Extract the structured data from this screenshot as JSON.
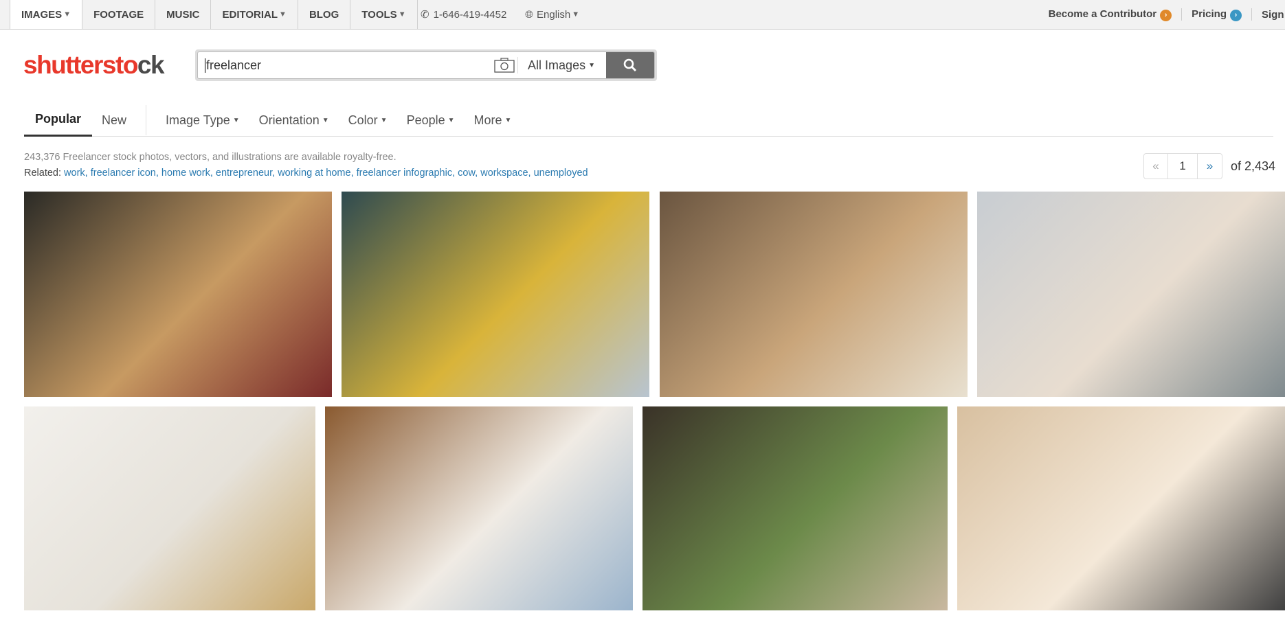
{
  "topnav": {
    "items": [
      {
        "label": "IMAGES",
        "caret": true
      },
      {
        "label": "FOOTAGE",
        "caret": false
      },
      {
        "label": "MUSIC",
        "caret": false
      },
      {
        "label": "EDITORIAL",
        "caret": true
      },
      {
        "label": "BLOG",
        "caret": false
      },
      {
        "label": "TOOLS",
        "caret": true
      }
    ],
    "phone": "1-646-419-4452",
    "language": "English",
    "contributor": "Become a Contributor",
    "pricing": "Pricing",
    "signin": "Sign In",
    "contributor_color": "#e0892a",
    "pricing_color": "#3a97c4"
  },
  "logo": {
    "text_a": "shutterst",
    "text_b": "o",
    "text_c": "ck"
  },
  "search": {
    "query": "freelancer",
    "scope": "All Images"
  },
  "filters": {
    "sort": [
      "Popular",
      "New"
    ],
    "active": "Popular",
    "menus": [
      "Image Type",
      "Orientation",
      "Color",
      "People",
      "More"
    ]
  },
  "results": {
    "count_text": "243,376 Freelancer stock photos, vectors, and illustrations are available royalty-free.",
    "related_label": "Related:",
    "related": [
      "work",
      "freelancer icon",
      "home work",
      "entrepreneur",
      "working at home",
      "freelancer infographic",
      "cow",
      "workspace",
      "unemployed"
    ]
  },
  "pagination": {
    "prev": "«",
    "page": "1",
    "next": "»",
    "of": "of 2,434"
  },
  "images": [
    {
      "colors": [
        "#2a2a26",
        "#c79a62",
        "#7a2a2a"
      ]
    },
    {
      "colors": [
        "#2e4a50",
        "#d9b43a",
        "#b8c4d0"
      ]
    },
    {
      "colors": [
        "#6a5540",
        "#c9a57a",
        "#e8e0d0"
      ]
    },
    {
      "colors": [
        "#c8cdd2",
        "#e8ddd0",
        "#7f8a8e"
      ]
    },
    {
      "colors": [
        "#f2f0ec",
        "#e6e2da",
        "#c9a86a"
      ]
    },
    {
      "colors": [
        "#8a5a30",
        "#f0ebe4",
        "#9bb4cc"
      ]
    },
    {
      "colors": [
        "#3a3228",
        "#6c8a4a",
        "#c9b8a0"
      ]
    },
    {
      "colors": [
        "#d8c0a0",
        "#f4e8d8",
        "#404040"
      ]
    }
  ]
}
